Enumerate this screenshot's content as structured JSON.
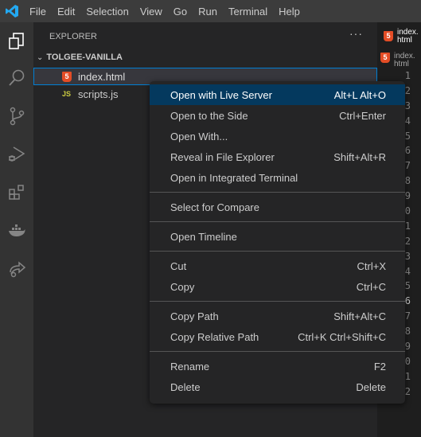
{
  "menubar": [
    "File",
    "Edit",
    "Selection",
    "View",
    "Go",
    "Run",
    "Terminal",
    "Help"
  ],
  "activity_bar": [
    "explorer-icon",
    "search-icon",
    "source-control-icon",
    "run-debug-icon",
    "extensions-icon",
    "docker-icon",
    "live-share-icon"
  ],
  "sidebar": {
    "title": "EXPLORER",
    "more": "···",
    "folder": "TOLGEE-VANILLA",
    "files": [
      {
        "name": "index.html",
        "icon": "html5-icon",
        "selected": true
      },
      {
        "name": "scripts.js",
        "icon": "js-icon",
        "icon_text": "JS"
      }
    ]
  },
  "editor": {
    "tab": "index.html",
    "breadcrumb": "index.html",
    "line_numbers": [
      "1",
      "2",
      "3",
      "4",
      "5",
      "6",
      "7",
      "8",
      "9",
      "10",
      "11",
      "12",
      "13",
      "14",
      "15",
      "16",
      "17",
      "18",
      "19",
      "20",
      "21",
      "22"
    ],
    "current_line": "16"
  },
  "context_menu": {
    "groups": [
      [
        {
          "label": "Open with Live Server",
          "shortcut": "Alt+L Alt+O",
          "highlighted": true
        },
        {
          "label": "Open to the Side",
          "shortcut": "Ctrl+Enter"
        },
        {
          "label": "Open With...",
          "shortcut": ""
        },
        {
          "label": "Reveal in File Explorer",
          "shortcut": "Shift+Alt+R"
        },
        {
          "label": "Open in Integrated Terminal",
          "shortcut": ""
        }
      ],
      [
        {
          "label": "Select for Compare",
          "shortcut": ""
        }
      ],
      [
        {
          "label": "Open Timeline",
          "shortcut": ""
        }
      ],
      [
        {
          "label": "Cut",
          "shortcut": "Ctrl+X"
        },
        {
          "label": "Copy",
          "shortcut": "Ctrl+C"
        }
      ],
      [
        {
          "label": "Copy Path",
          "shortcut": "Shift+Alt+C"
        },
        {
          "label": "Copy Relative Path",
          "shortcut": "Ctrl+K Ctrl+Shift+C"
        }
      ],
      [
        {
          "label": "Rename",
          "shortcut": "F2"
        },
        {
          "label": "Delete",
          "shortcut": "Delete"
        }
      ]
    ]
  },
  "colors": {
    "accent": "#007fd4",
    "highlight": "#04395e",
    "html": "#e44d26",
    "js": "#cbcb41"
  }
}
